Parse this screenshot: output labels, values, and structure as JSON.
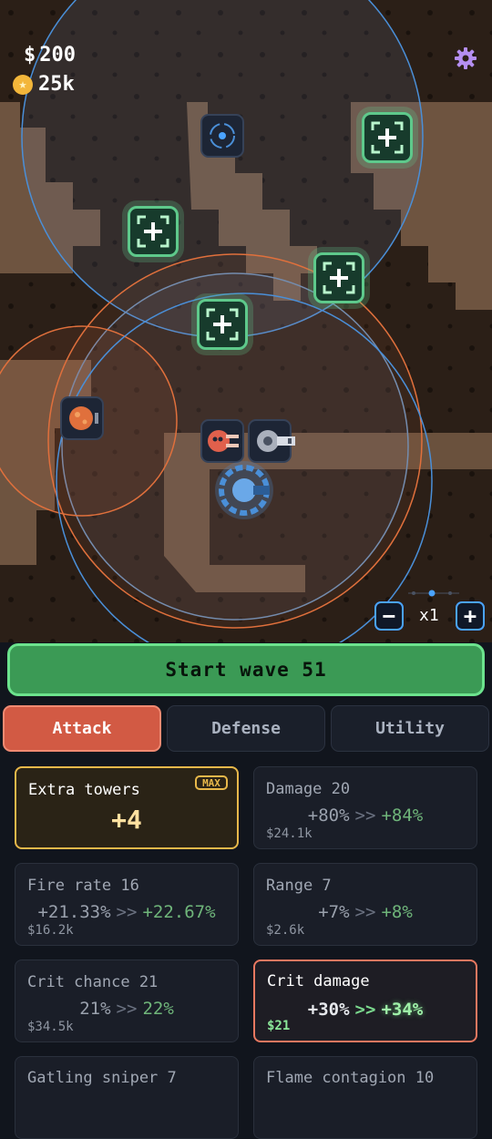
{
  "hud": {
    "money_symbol": "$",
    "money": "200",
    "gems": "25k",
    "star_icon": "★"
  },
  "speed": {
    "minus": "−",
    "label": "x1",
    "plus": "+"
  },
  "wave_button": "Start wave 51",
  "tabs": [
    {
      "label": "Attack",
      "active": true
    },
    {
      "label": "Defense",
      "active": false
    },
    {
      "label": "Utility",
      "active": false
    }
  ],
  "upgrades": [
    {
      "title": "Extra towers",
      "badge": "MAX",
      "value": "+4"
    },
    {
      "title": "Damage 20",
      "current": "+80%",
      "arrow": ">>",
      "next": "+84%",
      "cost": "$24.1k"
    },
    {
      "title": "Fire rate 16",
      "current": "+21.33%",
      "arrow": ">>",
      "next": "+22.67%",
      "cost": "$16.2k"
    },
    {
      "title": "Range 7",
      "current": "+7%",
      "arrow": ">>",
      "next": "+8%",
      "cost": "$2.6k"
    },
    {
      "title": "Crit chance 21",
      "current": "21%",
      "arrow": ">>",
      "next": "22%",
      "cost": "$34.5k"
    },
    {
      "title": "Crit damage",
      "current": "+30%",
      "arrow": ">>",
      "next": "+34%",
      "cost": "$21"
    },
    {
      "title": "Gatling sniper 7"
    },
    {
      "title": "Flame contagion 10"
    }
  ],
  "colors": {
    "accent_green": "#3b9a55",
    "tab_active": "#d25a44",
    "max_gold": "#e8b84a",
    "range_blue": "#4a8fd8",
    "range_orange": "#e0703c"
  }
}
